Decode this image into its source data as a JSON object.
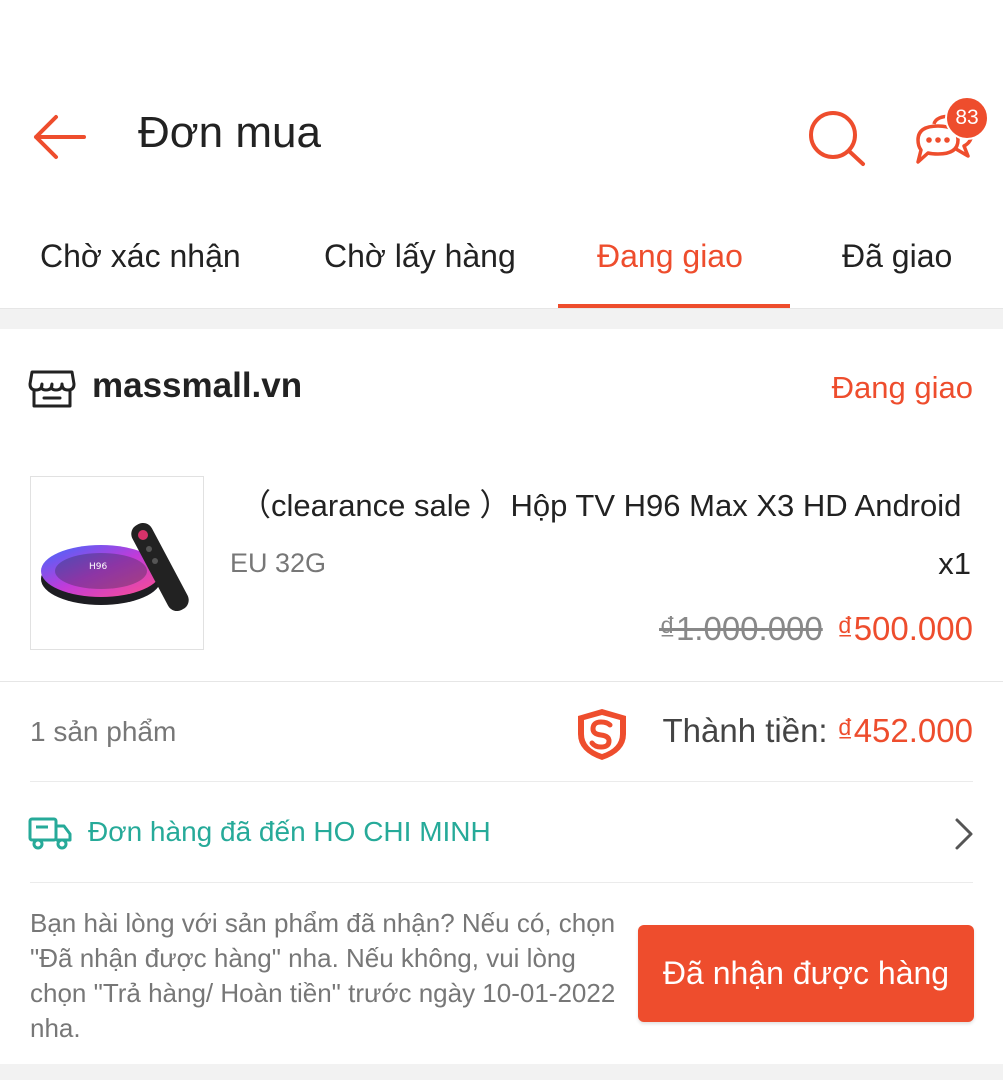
{
  "header": {
    "title": "Đơn mua",
    "back_icon": "arrow-left-icon",
    "search_icon": "search-icon",
    "chat_icon": "chat-bubbles-icon",
    "chat_badge_count": "83"
  },
  "tabs": [
    {
      "label": "Chờ xác nhận",
      "active": false
    },
    {
      "label": "Chờ lấy hàng",
      "active": false
    },
    {
      "label": "Đang giao",
      "active": true
    },
    {
      "label": "Đã giao",
      "active": false
    }
  ],
  "order": {
    "shop_icon": "store-icon",
    "shop_name": "massmall.vn",
    "status": "Đang giao",
    "product": {
      "name": "（clearance sale ）Hộp TV H96 Max X3 HD Android",
      "variant": "EU 32G",
      "quantity": "x1",
      "price_original": "₫1.000.000",
      "price_current": "₫500.000",
      "thumbnail": "tv-box-with-remote-image"
    },
    "summary": {
      "item_count": "1 sản phẩm",
      "guarantee_icon": "shield-s-icon",
      "total_label": "Thành tiền: ",
      "total_value": "₫452.000"
    },
    "shipping": {
      "icon": "truck-icon",
      "text": "Đơn hàng đã đến HO CHI MINH",
      "chevron_icon": "chevron-right-icon"
    },
    "notice": "Bạn hài lòng với sản phẩm đã nhận? Nếu có, chọn \"Đã nhận được hàng\" nha. Nếu không, vui lòng chọn \"Trả hàng/ Hoàn tiền\" trước ngày 10-01-2022 nha.",
    "confirm_button": "Đã nhận được hàng"
  },
  "colors": {
    "accent": "#ee4d2d",
    "shipping": "#26aa99",
    "muted_text": "#777777"
  }
}
